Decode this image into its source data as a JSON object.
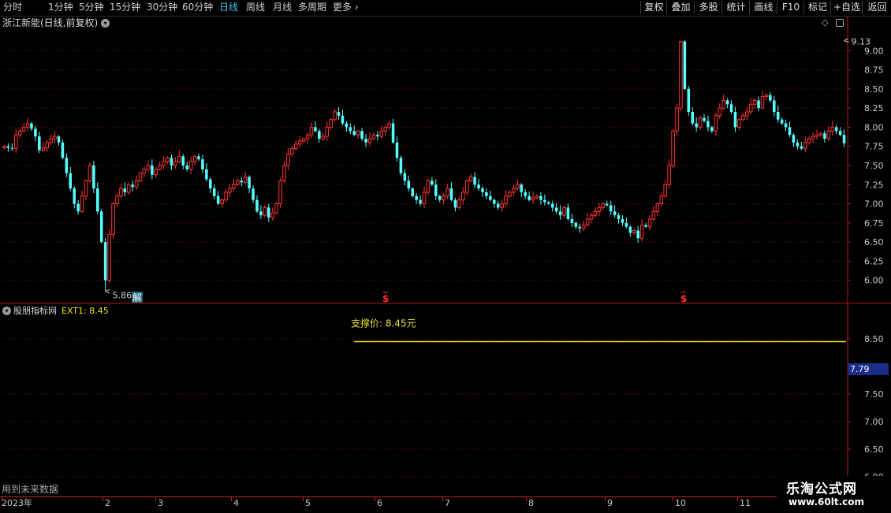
{
  "periods": [
    "分时",
    "1分钟",
    "5分钟",
    "15分钟",
    "30分钟",
    "60分钟",
    "日线",
    "周线",
    "月线",
    "多周期",
    "更多"
  ],
  "active_period": "日线",
  "toolbar": [
    "复权",
    "叠加",
    "多股",
    "统计",
    "画线",
    "F10",
    "标记",
    "+自选",
    "返回"
  ],
  "stock": {
    "title": "浙江新能(日线,前复权)"
  },
  "indicator": {
    "name": "股朋指标网",
    "ext1": "EXT1: 8.45",
    "support_text": "支撑价: 8.45元",
    "support_value": 8.45
  },
  "markers": [
    {
      "text": "解",
      "date_index": 2,
      "kind": "box"
    },
    {
      "text": "$",
      "date_index": 5,
      "kind": "sig"
    },
    {
      "text": "$",
      "date_index": 9,
      "kind": "sig"
    }
  ],
  "current_price": "7.79",
  "bottom_note": "用到未来数据",
  "dates": [
    "2023年",
    "2",
    "3",
    "4",
    "5",
    "6",
    "7",
    "8",
    "9",
    "10",
    "11"
  ],
  "logo": {
    "line1": "乐淘公式网",
    "line2": "www.60lt.com"
  },
  "chart_data": {
    "type": "candlestick",
    "up_color": "#ff3232",
    "down_color": "#54ffff",
    "main_ylim": [
      5.75,
      9.25
    ],
    "main_yticks": [
      "6.00",
      "6.25",
      "6.50",
      "6.75",
      "7.00",
      "7.25",
      "7.50",
      "7.75",
      "8.00",
      "8.25",
      "8.50",
      "8.75",
      "9.00"
    ],
    "high_label": "9.13",
    "low_label": "5.86",
    "sub_ylim": [
      6.0,
      9.0
    ],
    "sub_yticks": [
      "6.00",
      "6.50",
      "7.00",
      "7.50",
      "8.50"
    ],
    "closes": [
      7.75,
      7.73,
      7.72,
      7.9,
      7.95,
      8.0,
      8.05,
      7.98,
      7.88,
      7.7,
      7.73,
      7.8,
      7.85,
      7.88,
      7.8,
      7.6,
      7.4,
      7.2,
      7.0,
      6.9,
      7.1,
      7.3,
      7.5,
      7.2,
      6.9,
      6.5,
      6.0,
      6.6,
      7.0,
      7.1,
      7.2,
      7.15,
      7.25,
      7.22,
      7.3,
      7.4,
      7.45,
      7.5,
      7.38,
      7.45,
      7.5,
      7.55,
      7.6,
      7.5,
      7.55,
      7.62,
      7.5,
      7.45,
      7.55,
      7.62,
      7.58,
      7.45,
      7.32,
      7.2,
      7.1,
      7.0,
      7.05,
      7.15,
      7.2,
      7.25,
      7.3,
      7.28,
      7.35,
      7.2,
      7.05,
      6.9,
      6.85,
      6.95,
      6.82,
      6.88,
      7.0,
      7.3,
      7.5,
      7.65,
      7.72,
      7.78,
      7.82,
      7.85,
      7.9,
      8.0,
      7.95,
      7.85,
      7.88,
      8.0,
      8.1,
      8.2,
      8.15,
      8.05,
      8.0,
      7.95,
      7.9,
      7.95,
      7.85,
      7.8,
      7.85,
      7.9,
      7.88,
      7.95,
      8.0,
      8.05,
      7.8,
      7.6,
      7.4,
      7.3,
      7.2,
      7.1,
      7.05,
      7.0,
      7.15,
      7.3,
      7.25,
      7.1,
      7.05,
      7.1,
      7.2,
      7.05,
      6.95,
      7.05,
      7.15,
      7.3,
      7.35,
      7.25,
      7.2,
      7.15,
      7.1,
      7.05,
      7.0,
      6.95,
      7.0,
      7.1,
      7.15,
      7.2,
      7.25,
      7.15,
      7.1,
      7.05,
      7.08,
      7.1,
      7.05,
      7.02,
      7.0,
      6.95,
      6.9,
      6.85,
      6.95,
      6.8,
      6.75,
      6.7,
      6.68,
      6.72,
      6.8,
      6.85,
      6.9,
      6.95,
      7.0,
      6.98,
      6.9,
      6.85,
      6.8,
      6.75,
      6.7,
      6.62,
      6.65,
      6.55,
      6.72,
      6.7,
      6.8,
      6.9,
      7.0,
      7.1,
      7.25,
      7.5,
      7.95,
      8.25,
      9.12,
      8.5,
      8.2,
      8.05,
      8.0,
      8.12,
      8.08,
      8.0,
      7.95,
      8.15,
      8.25,
      8.35,
      8.3,
      8.2,
      8.0,
      8.1,
      8.15,
      8.2,
      8.3,
      8.35,
      8.25,
      8.4,
      8.42,
      8.35,
      8.2,
      8.1,
      8.05,
      8.0,
      7.9,
      7.8,
      7.75,
      7.72,
      7.8,
      7.85,
      7.88,
      7.9,
      7.92,
      7.85,
      7.95,
      8.0,
      7.95,
      7.9,
      7.79
    ]
  }
}
